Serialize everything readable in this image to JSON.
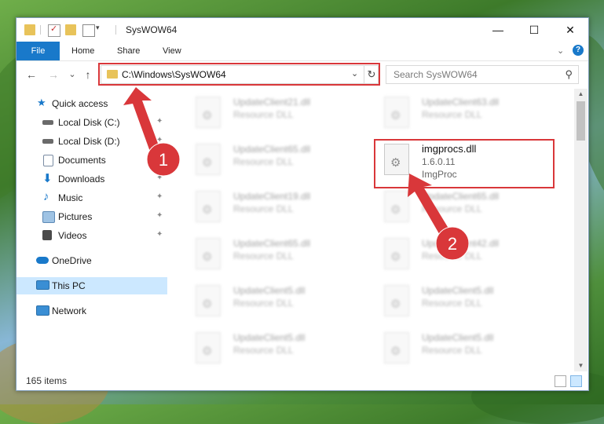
{
  "window": {
    "title": "SysWOW64",
    "controls": {
      "minimize": "—",
      "maximize": "☐",
      "close": "✕"
    }
  },
  "ribbon": {
    "tabs": [
      "File",
      "Home",
      "Share",
      "View"
    ],
    "expand_glyph": "⌄",
    "help_glyph": "?"
  },
  "navigation": {
    "back_glyph": "←",
    "forward_glyph": "→",
    "recent_glyph": "⌄",
    "up_glyph": "↑",
    "address": "C:\\Windows\\SysWOW64",
    "address_dropdown_glyph": "⌄",
    "refresh_glyph": "↻",
    "search_placeholder": "Search SysWOW64",
    "search_glyph": "⚲"
  },
  "sidebar": {
    "items": [
      {
        "label": "Quick access",
        "icon": "star-icon",
        "color": "#1979ca",
        "pinned": false
      },
      {
        "label": "Local Disk (C:)",
        "icon": "drive-icon",
        "color": "#6a6a6a",
        "pinned": true
      },
      {
        "label": "Local Disk (D:)",
        "icon": "drive-icon",
        "color": "#6a6a6a",
        "pinned": true
      },
      {
        "label": "Documents",
        "icon": "documents-icon",
        "color": "#7a8ca3",
        "pinned": true
      },
      {
        "label": "Downloads",
        "icon": "download-icon",
        "color": "#1979ca",
        "pinned": true
      },
      {
        "label": "Music",
        "icon": "music-icon",
        "color": "#1979ca",
        "pinned": true
      },
      {
        "label": "Pictures",
        "icon": "pictures-icon",
        "color": "#5b88b5",
        "pinned": true
      },
      {
        "label": "Videos",
        "icon": "videos-icon",
        "color": "#4a4a4a",
        "pinned": true
      },
      {
        "label": "OneDrive",
        "icon": "cloud-icon",
        "color": "#1979ca",
        "pinned": false
      },
      {
        "label": "This PC",
        "icon": "computer-icon",
        "color": "#3a8ed4",
        "pinned": false,
        "selected": true
      },
      {
        "label": "Network",
        "icon": "network-icon",
        "color": "#3a8ed4",
        "pinned": false
      }
    ],
    "pin_glyph": "📌"
  },
  "files": {
    "left_column": [
      {
        "name": "UpdateClient21.dll",
        "type": "Resource DLL"
      },
      {
        "name": "UpdateClient65.dll",
        "type": "Resource DLL"
      },
      {
        "name": "UpdateClient19.dll",
        "type": "Resource DLL"
      },
      {
        "name": "UpdateClient65.dll",
        "type": "Resource DLL"
      },
      {
        "name": "UpdateClient5.dll",
        "type": "Resource DLL"
      },
      {
        "name": "UpdateClient5.dll",
        "type": "Resource DLL"
      }
    ],
    "right_column": [
      {
        "name": "UpdateClient63.dll",
        "type": "Resource DLL"
      },
      {
        "name": "imgprocs.dll",
        "version": "1.6.0.11",
        "description": "ImgProc",
        "highlighted": true
      },
      {
        "name": "UpdateClient65.dll",
        "type": "Resource DLL"
      },
      {
        "name": "UpdateClient42.dll",
        "type": "Resource DLL"
      },
      {
        "name": "UpdateClient5.dll",
        "type": "Resource DLL"
      },
      {
        "name": "UpdateClient5.dll",
        "type": "Resource DLL"
      }
    ]
  },
  "status": {
    "item_count": "165 items"
  },
  "annotations": {
    "badge_1": "1",
    "badge_2": "2",
    "color": "#d9373a"
  }
}
